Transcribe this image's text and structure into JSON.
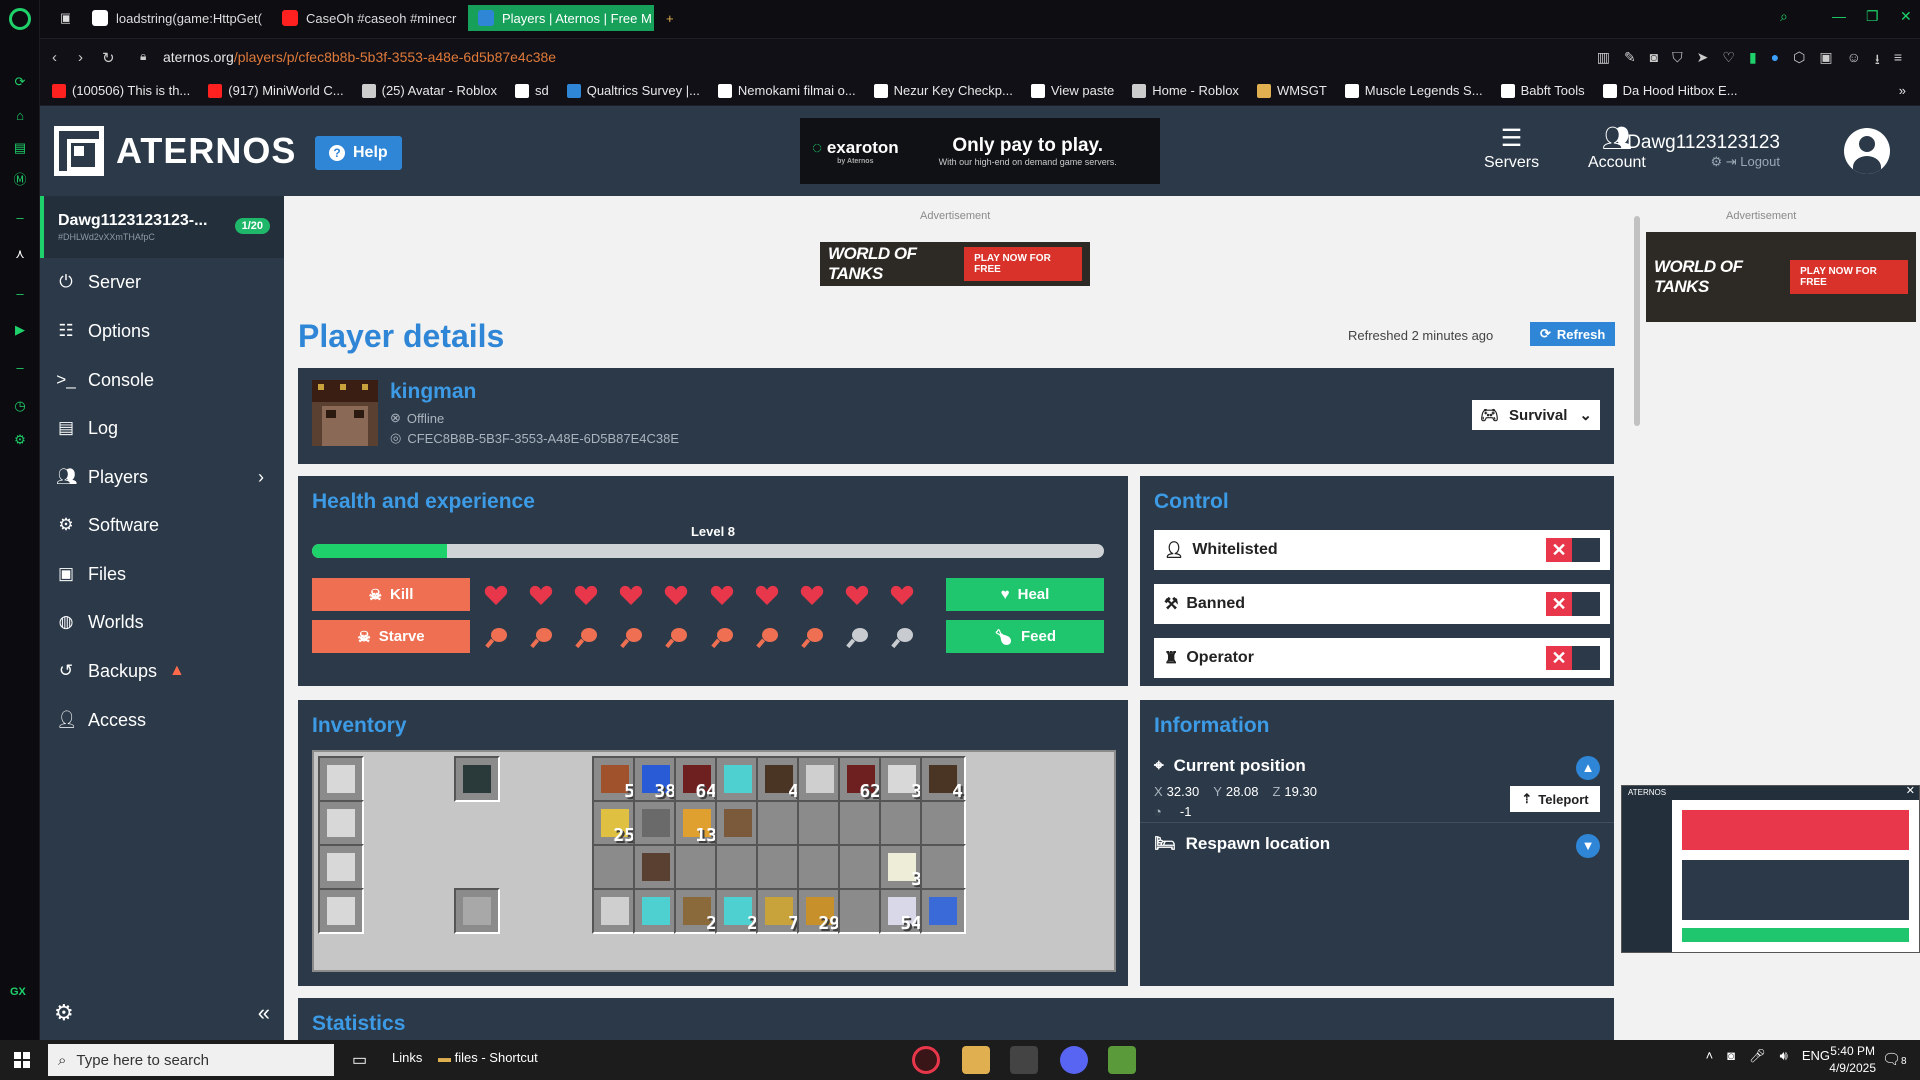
{
  "browser": {
    "tabs": [
      {
        "title": "loadstring(game:HttpGet(",
        "color": "#ffffff"
      },
      {
        "title": "CaseOh #caseoh #minecr",
        "color": "#ff2020"
      },
      {
        "title": "Players | Aternos | Free M",
        "color": "#2f86d6",
        "active": true
      }
    ],
    "url_host": "aternos.org",
    "url_path": "/players/p/cfec8b8b-5b3f-3553-a48e-6d5b87e4c38e",
    "bookmarks": [
      {
        "label": "(100506) This is th...",
        "color": "#ff2020"
      },
      {
        "label": "(917) MiniWorld C...",
        "color": "#ff2020"
      },
      {
        "label": "(25) Avatar - Roblox",
        "color": "#cccccc"
      },
      {
        "label": "sd",
        "color": "#ffffff"
      },
      {
        "label": "Qualtrics Survey |...",
        "color": "#2f86d6"
      },
      {
        "label": "Nemokami filmai o...",
        "color": "#ffffff"
      },
      {
        "label": "Nezur Key Checkp...",
        "color": "#ffffff"
      },
      {
        "label": "View paste",
        "color": "#ffffff"
      },
      {
        "label": "Home - Roblox",
        "color": "#cccccc"
      },
      {
        "label": "WMSGT",
        "color": "#e0b050"
      },
      {
        "label": "Muscle Legends S...",
        "color": "#ffffff"
      },
      {
        "label": "Babft Tools",
        "color": "#ffffff"
      },
      {
        "label": "Da Hood Hitbox E...",
        "color": "#ffffff"
      }
    ]
  },
  "header": {
    "brand": "ATERNOS",
    "help": "Help",
    "ad": {
      "logo": "exaroton",
      "logo_sub": "by Aternos",
      "headline": "Only pay to play.",
      "sub": "With our high-end on demand game servers."
    },
    "nav": [
      {
        "label": "Servers",
        "icon": "servers-icon"
      },
      {
        "label": "Account",
        "icon": "account-icon"
      }
    ],
    "username": "Dawg1123123123",
    "logout": "Logout"
  },
  "sidebar": {
    "server_name": "Dawg1123123123-...",
    "server_id": "#DHLWd2vXXmTHAfpC",
    "players_badge": "1/20",
    "items": [
      {
        "label": "Server",
        "icon": "power-icon"
      },
      {
        "label": "Options",
        "icon": "options-icon"
      },
      {
        "label": "Console",
        "icon": "console-icon"
      },
      {
        "label": "Log",
        "icon": "log-icon"
      },
      {
        "label": "Players",
        "icon": "players-icon"
      },
      {
        "label": "Software",
        "icon": "software-icon"
      },
      {
        "label": "Files",
        "icon": "files-icon"
      },
      {
        "label": "Worlds",
        "icon": "globe-icon"
      },
      {
        "label": "Backups",
        "icon": "backups-icon"
      },
      {
        "label": "Access",
        "icon": "access-icon"
      }
    ]
  },
  "ads": {
    "label": "Advertisement",
    "wot": "WORLD OF TANKS",
    "play": "PLAY NOW FOR FREE"
  },
  "main": {
    "title": "Player details",
    "refreshed": "Refreshed 2 minutes ago",
    "refresh": "Refresh",
    "player": {
      "name": "kingman",
      "status": "Offline",
      "uuid": "CFEC8B8B-5B3F-3553-A48E-6D5B87E4C38E",
      "gamemode": "Survival"
    },
    "health": {
      "title": "Health and experience",
      "level": "Level 8",
      "xp_fraction": 0.17,
      "hearts_full": 10,
      "hearts_total": 10,
      "food_full": 8,
      "food_total": 10,
      "kill": "Kill",
      "heal": "Heal",
      "starve": "Starve",
      "feed": "Feed"
    },
    "control": {
      "title": "Control",
      "rows": [
        {
          "label": "Whitelisted",
          "icon": "whitelist-icon",
          "enabled": false
        },
        {
          "label": "Banned",
          "icon": "ban-icon",
          "enabled": false
        },
        {
          "label": "Operator",
          "icon": "operator-icon",
          "enabled": false
        }
      ]
    },
    "inventory": {
      "title": "Inventory",
      "armor": [
        "helmet",
        "chestplate",
        "leggings",
        "boots"
      ],
      "main_row0": [
        {
          "item": "wood",
          "color": "#a0522d",
          "count": "5"
        },
        {
          "item": "lapis",
          "color": "#2a5bd7",
          "count": "38"
        },
        {
          "item": "netherrack",
          "color": "#6e1f1f",
          "count": "64"
        },
        {
          "item": "diamond-ore",
          "color": "#4fd0d0",
          "count": ""
        },
        {
          "item": "dirt",
          "color": "#4a3424",
          "count": "4"
        },
        {
          "item": "iron-boots",
          "color": "#cfcfcf",
          "count": ""
        },
        {
          "item": "netherrack",
          "color": "#6e1f1f",
          "count": "62"
        },
        {
          "item": "iron-ingot",
          "color": "#d8d8d8",
          "count": "3"
        },
        {
          "item": "dirt",
          "color": "#4a3424",
          "count": "4"
        }
      ],
      "main_row1": [
        {
          "item": "seeds",
          "color": "#e0c040",
          "count": "25"
        },
        {
          "item": "flint-steel",
          "color": "#6a6a6a",
          "count": ""
        },
        {
          "item": "torch",
          "color": "#e0a030",
          "count": "13"
        },
        {
          "item": "fishing-rod",
          "color": "#7a5a3a",
          "count": ""
        }
      ],
      "main_row2": [
        {
          "item": "",
          "color": "",
          "count": ""
        },
        {
          "item": "pickaxe",
          "color": "#5a4030",
          "count": ""
        },
        {
          "item": "",
          "color": "",
          "count": ""
        },
        {
          "item": "",
          "color": "",
          "count": ""
        },
        {
          "item": "",
          "color": "",
          "count": ""
        },
        {
          "item": "",
          "color": "",
          "count": ""
        },
        {
          "item": "",
          "color": "",
          "count": ""
        },
        {
          "item": "bone",
          "color": "#eeeed8",
          "count": "3"
        }
      ],
      "hotbar": [
        {
          "item": "iron-sword",
          "color": "#cfcfcf",
          "count": ""
        },
        {
          "item": "diamond-pickaxe",
          "color": "#4fd0d0",
          "count": ""
        },
        {
          "item": "stick",
          "color": "#8a6a3a",
          "count": "2"
        },
        {
          "item": "diamond",
          "color": "#4fd0d0",
          "count": "2"
        },
        {
          "item": "gold-ore",
          "color": "#c8a23a",
          "count": "7"
        },
        {
          "item": "potato",
          "color": "#c8902a",
          "count": "29"
        },
        {
          "item": "",
          "color": "",
          "count": ""
        },
        {
          "item": "iron-ore",
          "color": "#d8d8e8",
          "count": "54"
        },
        {
          "item": "water-bucket",
          "color": "#3a6ad7",
          "count": ""
        }
      ]
    },
    "information": {
      "title": "Information",
      "position_title": "Current position",
      "x": "32.30",
      "y": "28.08",
      "z": "19.30",
      "dimension": "-1",
      "teleport": "Teleport",
      "respawn_title": "Respawn location"
    },
    "statistics_title": "Statistics"
  },
  "taskbar": {
    "search_placeholder": "Type here to search",
    "links": "Links",
    "files_shortcut": "files - Shortcut",
    "lang": "ENG",
    "time": "5:40 PM",
    "date": "4/9/2025",
    "notif_count": "8"
  }
}
